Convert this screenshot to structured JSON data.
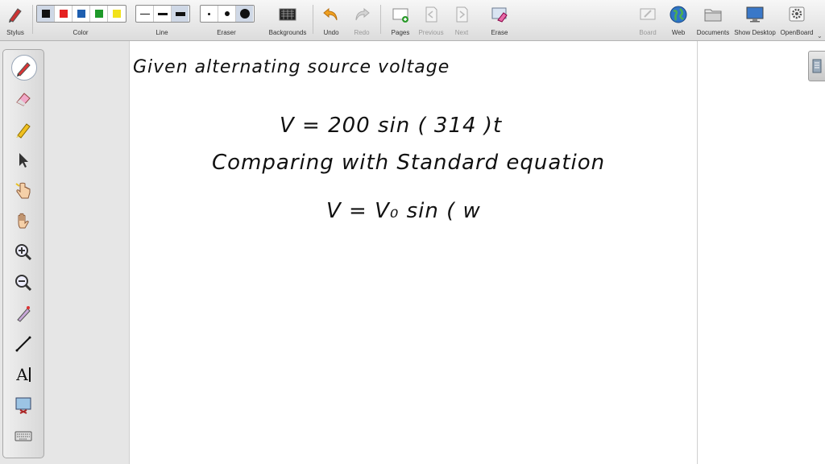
{
  "toolbar": {
    "stylus_label": "Stylus",
    "color_label": "Color",
    "line_label": "Line",
    "eraser_label": "Eraser",
    "backgrounds_label": "Backgrounds",
    "undo_label": "Undo",
    "redo_label": "Redo",
    "pages_label": "Pages",
    "previous_label": "Previous",
    "next_label": "Next",
    "erase_label": "Erase",
    "board_label": "Board",
    "web_label": "Web",
    "documents_label": "Documents",
    "show_desktop_label": "Show Desktop",
    "openboard_label": "OpenBoard",
    "colors": [
      "#111111",
      "#e52222",
      "#1f5fb0",
      "#1e9a2a",
      "#f2e21a"
    ]
  },
  "leftbar": {
    "tools": [
      "pen-icon",
      "eraser-icon",
      "highlighter-icon",
      "selector-icon",
      "pointer-hand-icon",
      "hand-icon",
      "zoom-in-icon",
      "zoom-out-icon",
      "laser-pointer-icon",
      "line-icon",
      "text-icon",
      "capture-icon",
      "keyboard-icon"
    ],
    "text_tool_glyph": "A"
  },
  "board": {
    "line1": "Given alternating source voltage",
    "line2": "V = 200 sin ( 314 )t",
    "line3": "Comparing with Standard equation",
    "line4": "V = V₀ sin ( w"
  }
}
